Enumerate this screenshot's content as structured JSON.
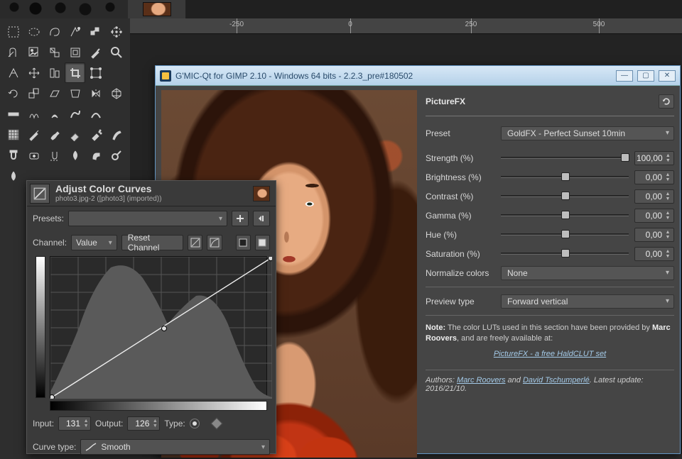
{
  "ruler": {
    "ticks": [
      "-250",
      "0",
      "250",
      "500"
    ]
  },
  "gmic": {
    "title": "G'MIC-Qt for GIMP 2.10 - Windows 64 bits - 2.2.3_pre#180502",
    "filter_name": "PictureFX",
    "preset_label": "Preset",
    "preset_value": "GoldFX - Perfect Sunset 10min",
    "params": [
      {
        "label": "Strength (%)",
        "value": "100,00",
        "pos": 94
      },
      {
        "label": "Brightness (%)",
        "value": "0,00",
        "pos": 47
      },
      {
        "label": "Contrast (%)",
        "value": "0,00",
        "pos": 47
      },
      {
        "label": "Gamma (%)",
        "value": "0,00",
        "pos": 47
      },
      {
        "label": "Hue (%)",
        "value": "0,00",
        "pos": 47
      },
      {
        "label": "Saturation (%)",
        "value": "0,00",
        "pos": 47
      }
    ],
    "normalize_label": "Normalize colors",
    "normalize_value": "None",
    "preview_label": "Preview type",
    "preview_value": "Forward vertical",
    "note_prefix": "Note:",
    "note_body1": " The color LUTs used in this section have been provided by ",
    "note_author": "Marc Roovers",
    "note_body2": ", and are freely available at:",
    "note_link": "PictureFX - a free HaldCLUT set",
    "authors_prefix": "Authors: ",
    "author1": "Marc Roovers",
    "authors_and": " and ",
    "author2": "David Tschumperlé",
    "authors_suffix1": ". Latest update: ",
    "authors_suffix2": "2016/21/10."
  },
  "curves": {
    "title": "Adjust Color Curves",
    "subtitle": "photo3.jpg-2 ([photo3] (imported))",
    "presets_label": "Presets:",
    "channel_label": "Channel:",
    "channel_value": "Value",
    "reset_label": "Reset Channel",
    "input_label": "Input:",
    "input_value": "131",
    "output_label": "Output:",
    "output_value": "126",
    "type_label": "Type:",
    "curve_type_label": "Curve type:",
    "curve_type_value": "Smooth"
  }
}
